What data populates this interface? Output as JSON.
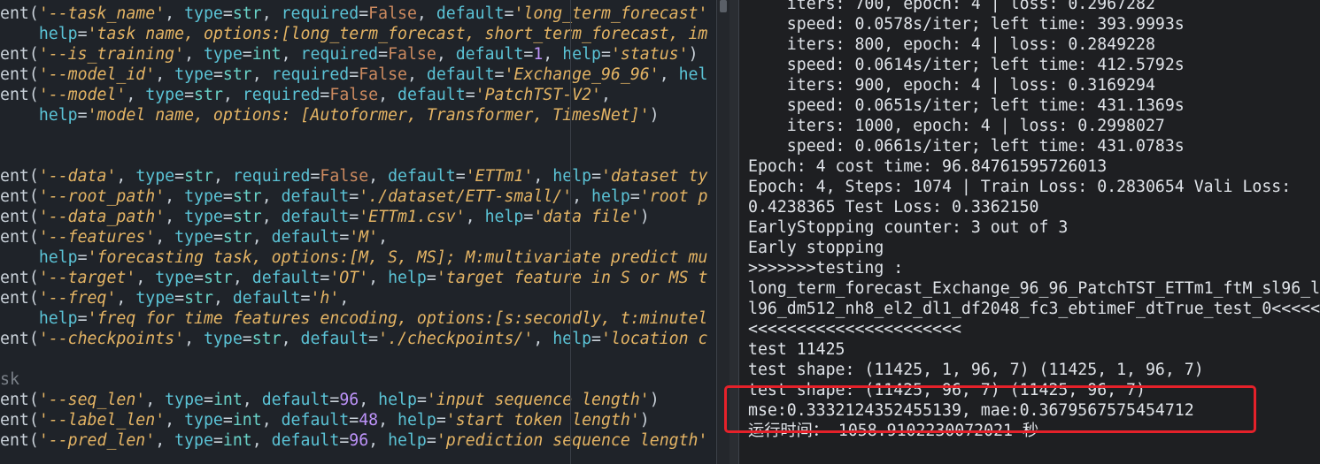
{
  "editor": {
    "lines": [
      [
        [
          "fn",
          "ent("
        ],
        [
          "s",
          "'--task_name'"
        ],
        [
          "p",
          ", "
        ],
        [
          "k",
          "type"
        ],
        [
          "p",
          "="
        ],
        [
          "t",
          "str"
        ],
        [
          "p",
          ", "
        ],
        [
          "k",
          "required"
        ],
        [
          "p",
          "="
        ],
        [
          "b",
          "False"
        ],
        [
          "p",
          ", "
        ],
        [
          "k",
          "default"
        ],
        [
          "p",
          "="
        ],
        [
          "s",
          "'long_term_forecast'"
        ]
      ],
      [
        [
          "p",
          "    "
        ],
        [
          "k",
          "help"
        ],
        [
          "p",
          "="
        ],
        [
          "s",
          "'task name, options:[long_term_forecast, short_term_forecast, im"
        ]
      ],
      [
        [
          "fn",
          "ent("
        ],
        [
          "s",
          "'--is_training'"
        ],
        [
          "p",
          ", "
        ],
        [
          "k",
          "type"
        ],
        [
          "p",
          "="
        ],
        [
          "t",
          "int"
        ],
        [
          "p",
          ", "
        ],
        [
          "k",
          "required"
        ],
        [
          "p",
          "="
        ],
        [
          "b",
          "False"
        ],
        [
          "p",
          ", "
        ],
        [
          "k",
          "default"
        ],
        [
          "p",
          "="
        ],
        [
          "n",
          "1"
        ],
        [
          "p",
          ", "
        ],
        [
          "k",
          "help"
        ],
        [
          "p",
          "="
        ],
        [
          "s",
          "'status'"
        ],
        [
          "p",
          ")"
        ]
      ],
      [
        [
          "fn",
          "ent("
        ],
        [
          "s",
          "'--model_id'"
        ],
        [
          "p",
          ", "
        ],
        [
          "k",
          "type"
        ],
        [
          "p",
          "="
        ],
        [
          "t",
          "str"
        ],
        [
          "p",
          ", "
        ],
        [
          "k",
          "required"
        ],
        [
          "p",
          "="
        ],
        [
          "b",
          "False"
        ],
        [
          "p",
          ", "
        ],
        [
          "k",
          "default"
        ],
        [
          "p",
          "="
        ],
        [
          "s",
          "'Exchange_96_96'"
        ],
        [
          "p",
          ", "
        ],
        [
          "k",
          "hel"
        ]
      ],
      [
        [
          "fn",
          "ent("
        ],
        [
          "s",
          "'--model'"
        ],
        [
          "p",
          ", "
        ],
        [
          "k",
          "type"
        ],
        [
          "p",
          "="
        ],
        [
          "t",
          "str"
        ],
        [
          "p",
          ", "
        ],
        [
          "k",
          "required"
        ],
        [
          "p",
          "="
        ],
        [
          "b",
          "False"
        ],
        [
          "p",
          ", "
        ],
        [
          "k",
          "default"
        ],
        [
          "p",
          "="
        ],
        [
          "s",
          "'PatchTST-V2'"
        ],
        [
          "p",
          ","
        ]
      ],
      [
        [
          "p",
          "    "
        ],
        [
          "k",
          "help"
        ],
        [
          "p",
          "="
        ],
        [
          "s",
          "'model name, options: [Autoformer, Transformer, TimesNet]'"
        ],
        [
          "p",
          ")"
        ]
      ],
      [],
      [],
      [
        [
          "fn",
          "ent("
        ],
        [
          "s",
          "'--data'"
        ],
        [
          "p",
          ", "
        ],
        [
          "k",
          "type"
        ],
        [
          "p",
          "="
        ],
        [
          "t",
          "str"
        ],
        [
          "p",
          ", "
        ],
        [
          "k",
          "required"
        ],
        [
          "p",
          "="
        ],
        [
          "b",
          "False"
        ],
        [
          "p",
          ", "
        ],
        [
          "k",
          "default"
        ],
        [
          "p",
          "="
        ],
        [
          "s",
          "'ETTm1'"
        ],
        [
          "p",
          ", "
        ],
        [
          "k",
          "help"
        ],
        [
          "p",
          "="
        ],
        [
          "s",
          "'dataset ty"
        ]
      ],
      [
        [
          "fn",
          "ent("
        ],
        [
          "s",
          "'--root_path'"
        ],
        [
          "p",
          ", "
        ],
        [
          "k",
          "type"
        ],
        [
          "p",
          "="
        ],
        [
          "t",
          "str"
        ],
        [
          "p",
          ", "
        ],
        [
          "k",
          "default"
        ],
        [
          "p",
          "="
        ],
        [
          "s",
          "'./dataset/ETT-small/'"
        ],
        [
          "p",
          ", "
        ],
        [
          "k",
          "help"
        ],
        [
          "p",
          "="
        ],
        [
          "s",
          "'root p"
        ]
      ],
      [
        [
          "fn",
          "ent("
        ],
        [
          "s",
          "'--data_path'"
        ],
        [
          "p",
          ", "
        ],
        [
          "k",
          "type"
        ],
        [
          "p",
          "="
        ],
        [
          "t",
          "str"
        ],
        [
          "p",
          ", "
        ],
        [
          "k",
          "default"
        ],
        [
          "p",
          "="
        ],
        [
          "s",
          "'ETTm1.csv'"
        ],
        [
          "p",
          ", "
        ],
        [
          "k",
          "help"
        ],
        [
          "p",
          "="
        ],
        [
          "s",
          "'data file'"
        ],
        [
          "p",
          ")"
        ]
      ],
      [
        [
          "fn",
          "ent("
        ],
        [
          "s",
          "'--features'"
        ],
        [
          "p",
          ", "
        ],
        [
          "k",
          "type"
        ],
        [
          "p",
          "="
        ],
        [
          "t",
          "str"
        ],
        [
          "p",
          ", "
        ],
        [
          "k",
          "default"
        ],
        [
          "p",
          "="
        ],
        [
          "s",
          "'M'"
        ],
        [
          "p",
          ","
        ]
      ],
      [
        [
          "p",
          "    "
        ],
        [
          "k",
          "help"
        ],
        [
          "p",
          "="
        ],
        [
          "s",
          "'forecasting task, options:[M, S, MS]; M:multivariate predict mu"
        ]
      ],
      [
        [
          "fn",
          "ent("
        ],
        [
          "s",
          "'--target'"
        ],
        [
          "p",
          ", "
        ],
        [
          "k",
          "type"
        ],
        [
          "p",
          "="
        ],
        [
          "t",
          "str"
        ],
        [
          "p",
          ", "
        ],
        [
          "k",
          "default"
        ],
        [
          "p",
          "="
        ],
        [
          "s",
          "'OT'"
        ],
        [
          "p",
          ", "
        ],
        [
          "k",
          "help"
        ],
        [
          "p",
          "="
        ],
        [
          "s",
          "'target feature in S or MS t"
        ]
      ],
      [
        [
          "fn",
          "ent("
        ],
        [
          "s",
          "'--freq'"
        ],
        [
          "p",
          ", "
        ],
        [
          "k",
          "type"
        ],
        [
          "p",
          "="
        ],
        [
          "t",
          "str"
        ],
        [
          "p",
          ", "
        ],
        [
          "k",
          "default"
        ],
        [
          "p",
          "="
        ],
        [
          "s",
          "'h'"
        ],
        [
          "p",
          ","
        ]
      ],
      [
        [
          "p",
          "    "
        ],
        [
          "k",
          "help"
        ],
        [
          "p",
          "="
        ],
        [
          "s",
          "'freq for time features encoding, options:[s:secondly, t:minutel"
        ]
      ],
      [
        [
          "fn",
          "ent("
        ],
        [
          "s",
          "'--checkpoints'"
        ],
        [
          "p",
          ", "
        ],
        [
          "k",
          "type"
        ],
        [
          "p",
          "="
        ],
        [
          "t",
          "str"
        ],
        [
          "p",
          ", "
        ],
        [
          "k",
          "default"
        ],
        [
          "p",
          "="
        ],
        [
          "s",
          "'./checkpoints/'"
        ],
        [
          "p",
          ", "
        ],
        [
          "k",
          "help"
        ],
        [
          "p",
          "="
        ],
        [
          "s",
          "'location c"
        ]
      ],
      [],
      [
        [
          "sec",
          "sk"
        ]
      ],
      [
        [
          "fn",
          "ent("
        ],
        [
          "s",
          "'--seq_len'"
        ],
        [
          "p",
          ", "
        ],
        [
          "k",
          "type"
        ],
        [
          "p",
          "="
        ],
        [
          "t",
          "int"
        ],
        [
          "p",
          ", "
        ],
        [
          "k",
          "default"
        ],
        [
          "p",
          "="
        ],
        [
          "n",
          "96"
        ],
        [
          "p",
          ", "
        ],
        [
          "k",
          "help"
        ],
        [
          "p",
          "="
        ],
        [
          "s",
          "'input sequence length'"
        ],
        [
          "p",
          ")"
        ]
      ],
      [
        [
          "fn",
          "ent("
        ],
        [
          "s",
          "'--label_len'"
        ],
        [
          "p",
          ", "
        ],
        [
          "k",
          "type"
        ],
        [
          "p",
          "="
        ],
        [
          "t",
          "int"
        ],
        [
          "p",
          ", "
        ],
        [
          "k",
          "default"
        ],
        [
          "p",
          "="
        ],
        [
          "n",
          "48"
        ],
        [
          "p",
          ", "
        ],
        [
          "k",
          "help"
        ],
        [
          "p",
          "="
        ],
        [
          "s",
          "'start token length'"
        ],
        [
          "p",
          ")"
        ]
      ],
      [
        [
          "fn",
          "ent("
        ],
        [
          "s",
          "'--pred_len'"
        ],
        [
          "p",
          ", "
        ],
        [
          "k",
          "type"
        ],
        [
          "p",
          "="
        ],
        [
          "t",
          "int"
        ],
        [
          "p",
          ", "
        ],
        [
          "k",
          "default"
        ],
        [
          "p",
          "="
        ],
        [
          "n",
          "96"
        ],
        [
          "p",
          ", "
        ],
        [
          "k",
          "help"
        ],
        [
          "p",
          "="
        ],
        [
          "s",
          "'prediction sequence length'"
        ]
      ]
    ]
  },
  "terminal": {
    "lines": [
      "    iters: 700, epoch: 4 | loss: 0.2967282",
      "    speed: 0.0578s/iter; left time: 393.9993s",
      "    iters: 800, epoch: 4 | loss: 0.2849228",
      "    speed: 0.0614s/iter; left time: 412.5792s",
      "    iters: 900, epoch: 4 | loss: 0.3169294",
      "    speed: 0.0651s/iter; left time: 431.1369s",
      "    iters: 1000, epoch: 4 | loss: 0.2998027",
      "    speed: 0.0661s/iter; left time: 431.0783s",
      "Epoch: 4 cost time: 96.84761595726013",
      "Epoch: 4, Steps: 1074 | Train Loss: 0.2830654 Vali Loss:",
      "0.4238365 Test Loss: 0.3362150",
      "EarlyStopping counter: 3 out of 3",
      "Early stopping",
      ">>>>>>>testing :",
      "long_term_forecast_Exchange_96_96_PatchTST_ETTm1_ftM_sl96_l",
      "l96_dm512_nh8_el2_dl1_df2048_fc3_ebtimeF_dtTrue_test_0<<<<<",
      "<<<<<<<<<<<<<<<<<<<<<<",
      "test 11425",
      "test shape: (11425, 1, 96, 7) (11425, 1, 96, 7)",
      "test shape: (11425, 96, 7) (11425, 96, 7)",
      "mse:0.3332124352455139, mae:0.3679567575454712",
      "运行时间： 1058.9102230072021 秒"
    ]
  }
}
